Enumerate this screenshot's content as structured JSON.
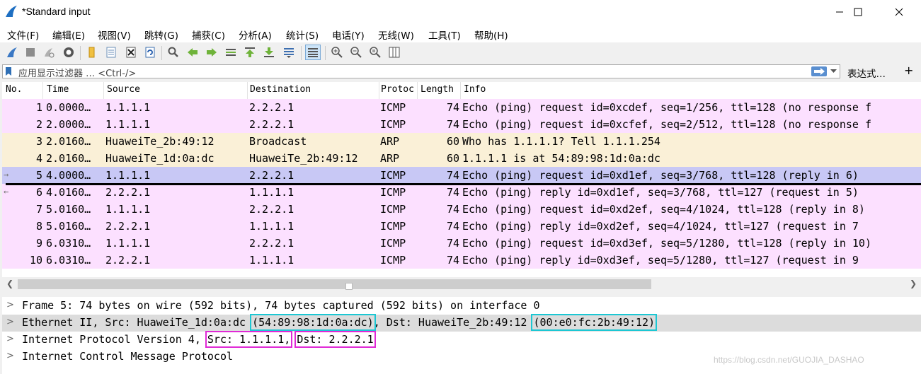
{
  "window": {
    "title": "*Standard input"
  },
  "menu": [
    "文件(F)",
    "编辑(E)",
    "视图(V)",
    "跳转(G)",
    "捕获(C)",
    "分析(A)",
    "统计(S)",
    "电话(Y)",
    "无线(W)",
    "工具(T)",
    "帮助(H)"
  ],
  "toolbar_icons": [
    "shark-fin-start-icon",
    "stop-icon",
    "restart-icon",
    "options-gear-icon",
    "open-folder-icon",
    "save-file-icon",
    "close-file-icon",
    "reload-icon",
    "find-magnifier-icon",
    "go-back-icon",
    "go-forward-icon",
    "go-to-packet-icon",
    "first-packet-icon",
    "last-packet-icon",
    "autoscroll-icon",
    "colorize-icon",
    "zoom-in-icon",
    "zoom-out-icon",
    "zoom-normal-icon",
    "resize-columns-icon"
  ],
  "filter": {
    "placeholder": "应用显示过滤器 … <Ctrl-/>",
    "expression_label": "表达式…",
    "add_label": "+"
  },
  "packet_list": {
    "columns": [
      "No.",
      "Time",
      "Source",
      "Destination",
      "Protoc",
      "Length",
      "Info"
    ],
    "rows": [
      {
        "no": "1",
        "time": "0.0000…",
        "src": "1.1.1.1",
        "dst": "2.2.2.1",
        "proto": "ICMP",
        "len": "74",
        "info": "Echo (ping) request  id=0xcdef, seq=1/256, ttl=128 (no response f"
      },
      {
        "no": "2",
        "time": "2.0000…",
        "src": "1.1.1.1",
        "dst": "2.2.2.1",
        "proto": "ICMP",
        "len": "74",
        "info": "Echo (ping) request  id=0xcfef, seq=2/512, ttl=128 (no response f"
      },
      {
        "no": "3",
        "time": "2.0160…",
        "src": "HuaweiTe_2b:49:12",
        "dst": "Broadcast",
        "proto": "ARP",
        "len": "60",
        "info": "Who has 1.1.1.1? Tell 1.1.1.254"
      },
      {
        "no": "4",
        "time": "2.0160…",
        "src": "HuaweiTe_1d:0a:dc",
        "dst": "HuaweiTe_2b:49:12",
        "proto": "ARP",
        "len": "60",
        "info": "1.1.1.1 is at 54:89:98:1d:0a:dc"
      },
      {
        "no": "5",
        "time": "4.0000…",
        "src": "1.1.1.1",
        "dst": "2.2.2.1",
        "proto": "ICMP",
        "len": "74",
        "info": "Echo (ping) request  id=0xd1ef, seq=3/768, ttl=128 (reply in 6)"
      },
      {
        "no": "6",
        "time": "4.0160…",
        "src": "2.2.2.1",
        "dst": "1.1.1.1",
        "proto": "ICMP",
        "len": "74",
        "info": "Echo (ping) reply    id=0xd1ef, seq=3/768, ttl=127 (request in 5)"
      },
      {
        "no": "7",
        "time": "5.0160…",
        "src": "1.1.1.1",
        "dst": "2.2.2.1",
        "proto": "ICMP",
        "len": "74",
        "info": "Echo (ping) request  id=0xd2ef, seq=4/1024, ttl=128 (reply in 8)"
      },
      {
        "no": "8",
        "time": "5.0160…",
        "src": "2.2.2.1",
        "dst": "1.1.1.1",
        "proto": "ICMP",
        "len": "74",
        "info": "Echo (ping) reply    id=0xd2ef, seq=4/1024, ttl=127 (request in 7"
      },
      {
        "no": "9",
        "time": "6.0310…",
        "src": "1.1.1.1",
        "dst": "2.2.2.1",
        "proto": "ICMP",
        "len": "74",
        "info": "Echo (ping) request  id=0xd3ef, seq=5/1280, ttl=128 (reply in 10)"
      },
      {
        "no": "10",
        "time": "6.0310…",
        "src": "2.2.2.1",
        "dst": "1.1.1.1",
        "proto": "ICMP",
        "len": "74",
        "info": "Echo (ping) reply    id=0xd3ef, seq=5/1280, ttl=127 (request in 9"
      }
    ],
    "selected_row": "5",
    "colors": {
      "icmp": "#fce0ff",
      "arp": "#faf0d7",
      "selected": "#c8c8f5"
    }
  },
  "details": {
    "frame": "Frame 5: 74 bytes on wire (592 bits), 74 bytes captured (592 bits) on interface 0",
    "ethernet": {
      "prefix": "Ethernet II, Src: HuaweiTe_1d:0a:dc ",
      "src_mac": "(54:89:98:1d:0a:dc)",
      "middle": ", Dst: HuaweiTe_2b:49:12 ",
      "dst_mac": "(00:e0:fc:2b:49:12)"
    },
    "ip": {
      "prefix": "Internet Protocol Version 4, ",
      "src": "Src: 1.1.1.1,",
      "dst": "Dst: 2.2.2.1"
    },
    "icmp": "Internet Control Message Protocol",
    "highlight_colors": {
      "cyan": "#1cc7d3",
      "magenta": "#e02ad6"
    }
  },
  "watermark": "https://blog.csdn.net/GUOJIA_DASHAO"
}
